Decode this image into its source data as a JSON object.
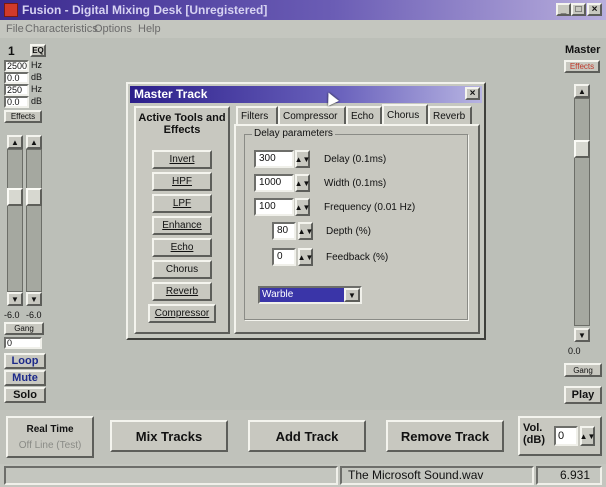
{
  "window": {
    "title": "Fusion - Digital Mixing Desk [Unregistered]",
    "minimize": "_",
    "maximize": "□",
    "close": "×"
  },
  "menu": [
    "File",
    "Characteristics",
    "Options",
    "Help"
  ],
  "left_strip": {
    "track_number": "1",
    "eq_button": "EQ",
    "rows": [
      {
        "value": "2500",
        "unit": "Hz"
      },
      {
        "value": "0.0",
        "unit": "dB"
      },
      {
        "value": "250",
        "unit": "Hz"
      },
      {
        "value": "0.0",
        "unit": "dB"
      }
    ],
    "effects_label": "Effects",
    "level_left": "-6.0",
    "level_right": "-6.0",
    "gang_label": "Gang",
    "gang_value": "0",
    "loop": "Loop",
    "mute": "Mute",
    "solo": "Solo"
  },
  "master_strip": {
    "title": "Master",
    "effects_label": "Effects",
    "level": "0.0",
    "gang_label": "Gang",
    "play": "Play"
  },
  "dialog": {
    "title": "Master Track",
    "close": "×",
    "tools_heading": "Active Tools and Effects",
    "tools": [
      "Invert",
      "HPF",
      "LPF",
      "Enhance",
      "Echo",
      "Chorus",
      "Reverb",
      "Compressor"
    ],
    "tabs": [
      "Filters",
      "Compressor",
      "Echo",
      "Chorus",
      "Reverb"
    ],
    "active_tab": "Chorus",
    "group_label": "Delay parameters",
    "params": [
      {
        "value": "300",
        "label": "Delay (0.1ms)"
      },
      {
        "value": "1000",
        "label": "Width (0.1ms)"
      },
      {
        "value": "100",
        "label": "Frequency (0.01 Hz)"
      },
      {
        "value": "80",
        "label": "Depth (%)"
      },
      {
        "value": "0",
        "label": "Feedback (%)"
      }
    ],
    "mode_select": "Warble"
  },
  "bottom": {
    "real_time": "Real Time",
    "off_line": "Off Line (Test)",
    "mix_tracks": "Mix Tracks",
    "add_track": "Add Track",
    "remove_track": "Remove Track",
    "vol_label": "Vol. (dB)",
    "vol_value": "0"
  },
  "status": {
    "file": "The Microsoft Sound.wav",
    "duration": "6.931"
  },
  "colors": {
    "title_gradient_start": "#3b2a8f",
    "dialog_title_start": "#2b1e8a",
    "face": "#c8c8c0",
    "mode_select_highlight": "#3a35a8",
    "master_effects_text": "#c0392b"
  }
}
